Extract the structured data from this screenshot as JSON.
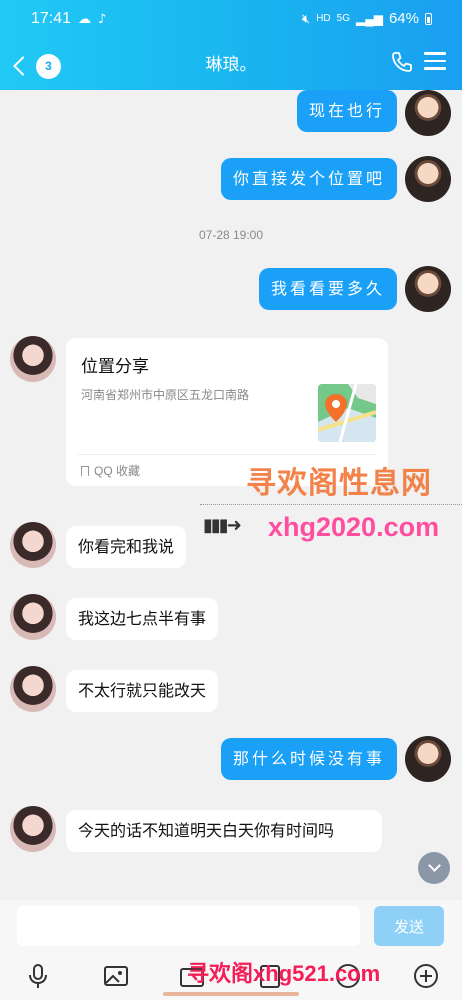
{
  "status_bar": {
    "time": "17:41",
    "net_hd": "HD",
    "net_5g": "5G",
    "battery": "64%"
  },
  "header": {
    "unread_count": "3",
    "title": "琳琅。"
  },
  "messages": [
    {
      "side": "out",
      "text": "现在也行"
    },
    {
      "side": "out",
      "text": "你直接发个位置吧"
    },
    {
      "side": "time",
      "text": "07-28 19:00"
    },
    {
      "side": "out",
      "text": "我看看要多久"
    },
    {
      "side": "in",
      "text": "你看完和我说"
    },
    {
      "side": "in",
      "text": "我这边七点半有事"
    },
    {
      "side": "in",
      "text": "不太行就只能改天"
    },
    {
      "side": "out",
      "text": "那什么时候没有事"
    },
    {
      "side": "in",
      "text": "今天的话不知道明天白天你有时间吗"
    }
  ],
  "location_card": {
    "title": "位置分享",
    "address": "河南省郑州市中原区五龙口南路",
    "source": "QQ 收藏"
  },
  "watermarks": {
    "top_cn": "寻欢阁性息网",
    "top_url": "xhg2020.com",
    "bottom_cn": "寻欢阁",
    "bottom_url": "xhg521.com"
  },
  "input": {
    "placeholder": "",
    "send_label": "发送"
  },
  "icons": {
    "back": "chevron-left-icon",
    "call": "phone-icon",
    "menu": "menu-icon",
    "scroll": "chevron-down-icon"
  },
  "colors": {
    "header_start": "#22c9f5",
    "header_end": "#1a9ff0",
    "outgoing_bubble": "#1aa0f7",
    "send_button": "#8fd0f7"
  }
}
